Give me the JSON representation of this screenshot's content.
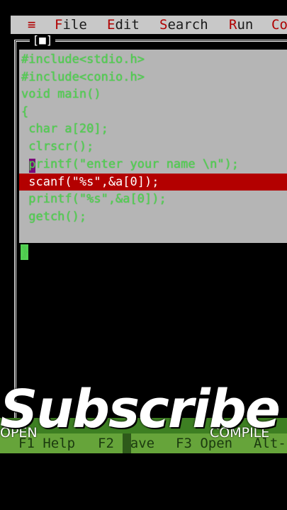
{
  "menu": {
    "system": "≡",
    "items": [
      {
        "hot": "F",
        "rest": "ile"
      },
      {
        "hot": "E",
        "rest": "dit"
      },
      {
        "hot": "S",
        "rest": "earch"
      },
      {
        "hot": "R",
        "rest": "un"
      },
      {
        "hot": "Co",
        "rest": ""
      }
    ]
  },
  "editor": {
    "window_marker": "[■]",
    "lines": [
      "#include<stdio.h>",
      "#include<conio.h>",
      "void main()",
      "{",
      " char a[20];",
      " clrscr();",
      " printf(\"enter your name \\n\");",
      " scanf(\"%s\",&a[0]);",
      " printf(\"%s\",&a[0]);",
      " getch();",
      "",
      "}"
    ]
  },
  "fkeys": {
    "f1_key": "F1",
    "f1_label": "Help",
    "f2_key": "F2",
    "f2_label": "Save",
    "f3_key": "F3",
    "f3_label": "Open",
    "alt": "Alt-"
  },
  "overlay": {
    "left_label": "OPEN",
    "right_label": "COMPILE",
    "subscribe": "Subscribe"
  }
}
